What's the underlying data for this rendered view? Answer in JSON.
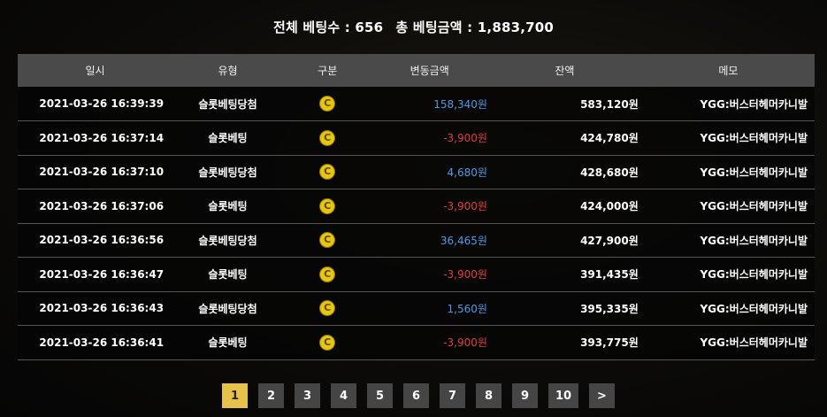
{
  "summary": {
    "total_bets_label": "전체 베팅수 : 656",
    "total_amount_label": "총 베팅금액 : 1,883,700"
  },
  "table": {
    "headers": [
      "일시",
      "유형",
      "구분",
      "변동금액",
      "잔액",
      "메모"
    ],
    "rows": [
      {
        "date": "2021-03-26 16:39:39",
        "type": "슬롯베팅당첨",
        "category_icon": "coin-icon",
        "amount": "158,340원",
        "amount_sign": "positive",
        "balance": "583,120원",
        "memo": "YGG:버스터헤머카니발"
      },
      {
        "date": "2021-03-26 16:37:14",
        "type": "슬롯베팅",
        "category_icon": "coin-icon",
        "amount": "-3,900원",
        "amount_sign": "negative",
        "balance": "424,780원",
        "memo": "YGG:버스터헤머카니발"
      },
      {
        "date": "2021-03-26 16:37:10",
        "type": "슬롯베팅당첨",
        "category_icon": "coin-icon",
        "amount": "4,680원",
        "amount_sign": "positive",
        "balance": "428,680원",
        "memo": "YGG:버스터헤머카니발"
      },
      {
        "date": "2021-03-26 16:37:06",
        "type": "슬롯베팅",
        "category_icon": "coin-icon",
        "amount": "-3,900원",
        "amount_sign": "negative",
        "balance": "424,000원",
        "memo": "YGG:버스터헤머카니발"
      },
      {
        "date": "2021-03-26 16:36:56",
        "type": "슬롯베팅당첨",
        "category_icon": "coin-icon",
        "amount": "36,465원",
        "amount_sign": "positive",
        "balance": "427,900원",
        "memo": "YGG:버스터헤머카니발"
      },
      {
        "date": "2021-03-26 16:36:47",
        "type": "슬롯베팅",
        "category_icon": "coin-icon",
        "amount": "-3,900원",
        "amount_sign": "negative",
        "balance": "391,435원",
        "memo": "YGG:버스터헤머카니발"
      },
      {
        "date": "2021-03-26 16:36:43",
        "type": "슬롯베팅당첨",
        "category_icon": "coin-icon",
        "amount": "1,560원",
        "amount_sign": "positive",
        "balance": "395,335원",
        "memo": "YGG:버스터헤머카니발"
      },
      {
        "date": "2021-03-26 16:36:41",
        "type": "슬롯베팅",
        "category_icon": "coin-icon",
        "amount": "-3,900원",
        "amount_sign": "negative",
        "balance": "393,775원",
        "memo": "YGG:버스터헤머카니발"
      }
    ]
  },
  "coin_glyph": "C",
  "pagination": {
    "pages": [
      "1",
      "2",
      "3",
      "4",
      "5",
      "6",
      "7",
      "8",
      "9",
      "10"
    ],
    "active": "1",
    "next_label": ">"
  },
  "colors": {
    "positive": "#4a9be8",
    "negative": "#e23c3c",
    "active_page": "#e8c14a",
    "header_bg": "#4a4a4a"
  }
}
